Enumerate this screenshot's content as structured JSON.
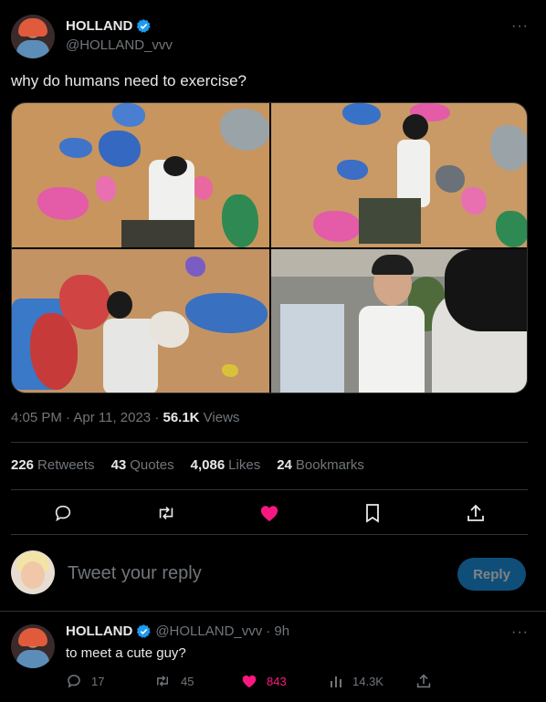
{
  "tweet": {
    "display_name": "HOLLAND",
    "handle": "@HOLLAND_vvv",
    "text": "why do humans need to exercise?",
    "time": "4:05 PM · Apr 11, 2023 · ",
    "views_count": "56.1K",
    "views_label": " Views",
    "more": "···"
  },
  "stats": [
    {
      "count": "226",
      "label": "Retweets"
    },
    {
      "count": "43",
      "label": "Quotes"
    },
    {
      "count": "4,086",
      "label": "Likes"
    },
    {
      "count": "24",
      "label": "Bookmarks"
    }
  ],
  "reply_box": {
    "placeholder": "Tweet your reply",
    "button": "Reply"
  },
  "reply": {
    "display_name": "HOLLAND",
    "handle": "@HOLLAND_vvv",
    "age": "· 9h",
    "text": "to meet a cute guy?",
    "more": "···",
    "replies": "17",
    "retweets": "45",
    "likes": "843",
    "views": "14.3K"
  },
  "colors": {
    "like_active": "#f91880",
    "verified": "#1d9bf0",
    "reply_button_bg": "#0f4e78"
  },
  "icons": [
    "reply-icon",
    "retweet-icon",
    "heart-icon",
    "bookmark-icon",
    "share-icon",
    "views-icon",
    "verified-icon",
    "more-icon"
  ]
}
